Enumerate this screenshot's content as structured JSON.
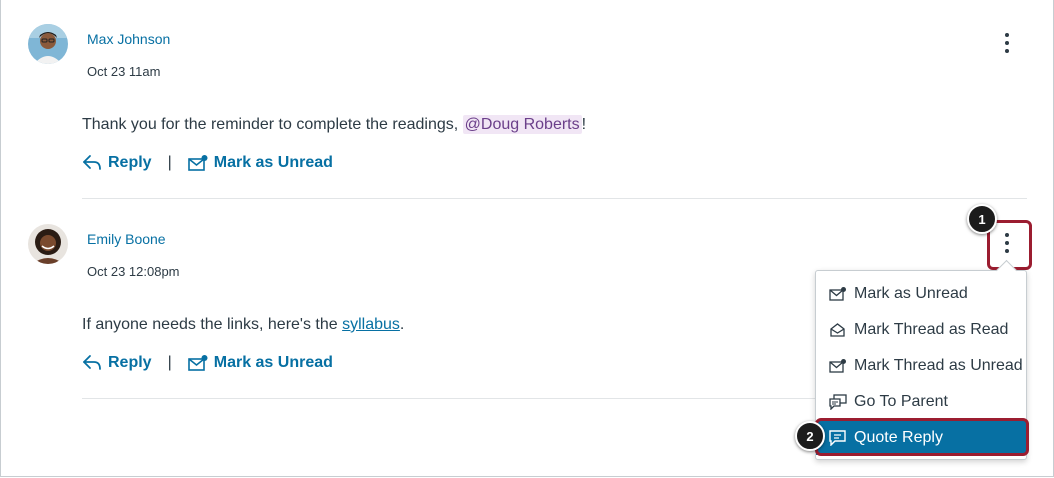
{
  "entries": [
    {
      "author": "Max Johnson",
      "timestamp": "Oct 23 11am",
      "body_prefix": "Thank you for the reminder to complete the readings, ",
      "mention": "@Doug Roberts",
      "body_suffix": "!",
      "reply_label": "Reply",
      "mark_label": "Mark as Unread"
    },
    {
      "author": "Emily Boone",
      "timestamp": "Oct 23 12:08pm",
      "body_prefix": "If anyone needs the links, here's the ",
      "link_text": "syllabus",
      "body_suffix": ".",
      "reply_label": "Reply",
      "mark_label": "Mark as Unread"
    }
  ],
  "separator": "|",
  "menu": {
    "items": [
      {
        "label": "Mark as Unread",
        "icon": "envelope-unread-icon"
      },
      {
        "label": "Mark Thread as Read",
        "icon": "envelope-open-icon"
      },
      {
        "label": "Mark Thread as Unread",
        "icon": "envelope-unread-icon"
      },
      {
        "label": "Go To Parent",
        "icon": "discussion-icon"
      },
      {
        "label": "Quote Reply",
        "icon": "quote-reply-icon",
        "selected": true
      }
    ]
  },
  "callouts": [
    "1",
    "2"
  ],
  "colors": {
    "link": "#0770a3",
    "text": "#2d3b45",
    "highlight": "#9b1d30",
    "mention_bg": "#f1e6f5",
    "selected_bg": "#0770a3"
  }
}
